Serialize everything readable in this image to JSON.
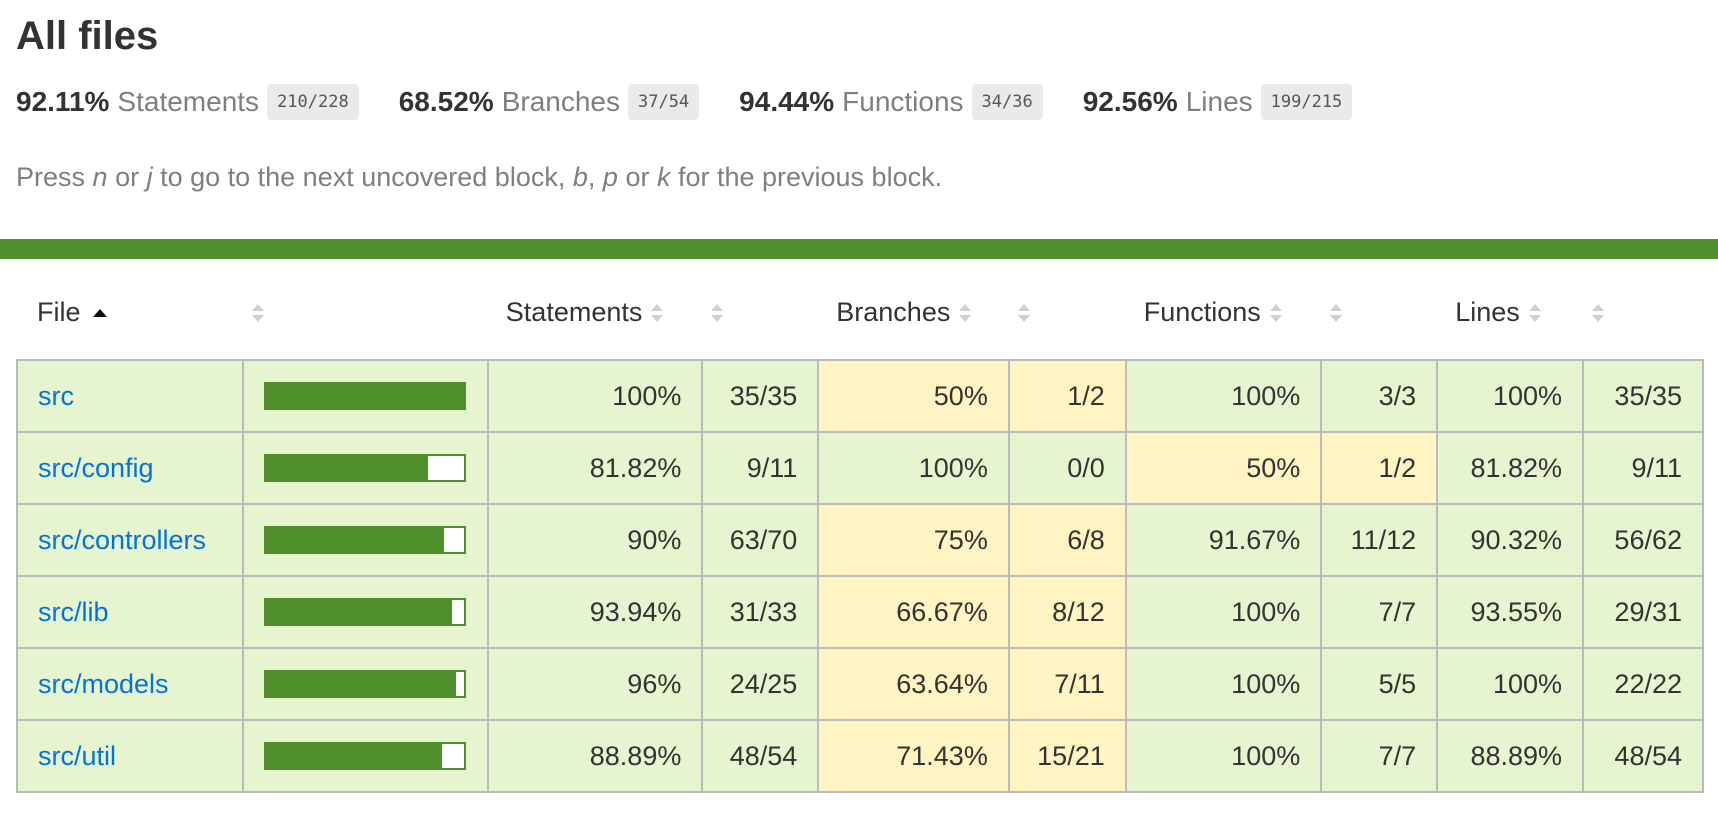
{
  "page": {
    "title": "All files",
    "summary": [
      {
        "pct": "92.11%",
        "label": "Statements",
        "fraction": "210/228"
      },
      {
        "pct": "68.52%",
        "label": "Branches",
        "fraction": "37/54"
      },
      {
        "pct": "94.44%",
        "label": "Functions",
        "fraction": "34/36"
      },
      {
        "pct": "92.56%",
        "label": "Lines",
        "fraction": "199/215"
      }
    ],
    "hint": {
      "t1": "Press ",
      "k1": "n",
      "t2": " or ",
      "k2": "j",
      "t3": " to go to the next uncovered block, ",
      "k3": "b",
      "t4": ", ",
      "k4": "p",
      "t5": " or ",
      "k5": "k",
      "t6": " for the previous block."
    },
    "status_color": "#4f902c"
  },
  "table": {
    "headers": {
      "file": "File",
      "statements": "Statements",
      "branches": "Branches",
      "functions": "Functions",
      "lines": "Lines"
    },
    "sort": {
      "column": "file",
      "direction": "ascending"
    },
    "rows": [
      {
        "file": "src",
        "coverage_pct": 100,
        "statements": {
          "pct": "100%",
          "abs": "35/35",
          "level": "high"
        },
        "branches": {
          "pct": "50%",
          "abs": "1/2",
          "level": "medium"
        },
        "functions": {
          "pct": "100%",
          "abs": "3/3",
          "level": "high"
        },
        "lines": {
          "pct": "100%",
          "abs": "35/35",
          "level": "high"
        }
      },
      {
        "file": "src/config",
        "coverage_pct": 81.82,
        "statements": {
          "pct": "81.82%",
          "abs": "9/11",
          "level": "high"
        },
        "branches": {
          "pct": "100%",
          "abs": "0/0",
          "level": "high"
        },
        "functions": {
          "pct": "50%",
          "abs": "1/2",
          "level": "medium"
        },
        "lines": {
          "pct": "81.82%",
          "abs": "9/11",
          "level": "high"
        }
      },
      {
        "file": "src/controllers",
        "coverage_pct": 90,
        "statements": {
          "pct": "90%",
          "abs": "63/70",
          "level": "high"
        },
        "branches": {
          "pct": "75%",
          "abs": "6/8",
          "level": "medium"
        },
        "functions": {
          "pct": "91.67%",
          "abs": "11/12",
          "level": "high"
        },
        "lines": {
          "pct": "90.32%",
          "abs": "56/62",
          "level": "high"
        }
      },
      {
        "file": "src/lib",
        "coverage_pct": 93.94,
        "statements": {
          "pct": "93.94%",
          "abs": "31/33",
          "level": "high"
        },
        "branches": {
          "pct": "66.67%",
          "abs": "8/12",
          "level": "medium"
        },
        "functions": {
          "pct": "100%",
          "abs": "7/7",
          "level": "high"
        },
        "lines": {
          "pct": "93.55%",
          "abs": "29/31",
          "level": "high"
        }
      },
      {
        "file": "src/models",
        "coverage_pct": 96,
        "statements": {
          "pct": "96%",
          "abs": "24/25",
          "level": "high"
        },
        "branches": {
          "pct": "63.64%",
          "abs": "7/11",
          "level": "medium"
        },
        "functions": {
          "pct": "100%",
          "abs": "5/5",
          "level": "high"
        },
        "lines": {
          "pct": "100%",
          "abs": "22/22",
          "level": "high"
        }
      },
      {
        "file": "src/util",
        "coverage_pct": 88.89,
        "statements": {
          "pct": "88.89%",
          "abs": "48/54",
          "level": "high"
        },
        "branches": {
          "pct": "71.43%",
          "abs": "15/21",
          "level": "medium"
        },
        "functions": {
          "pct": "100%",
          "abs": "7/7",
          "level": "high"
        },
        "lines": {
          "pct": "88.89%",
          "abs": "48/54",
          "level": "high"
        }
      }
    ]
  }
}
